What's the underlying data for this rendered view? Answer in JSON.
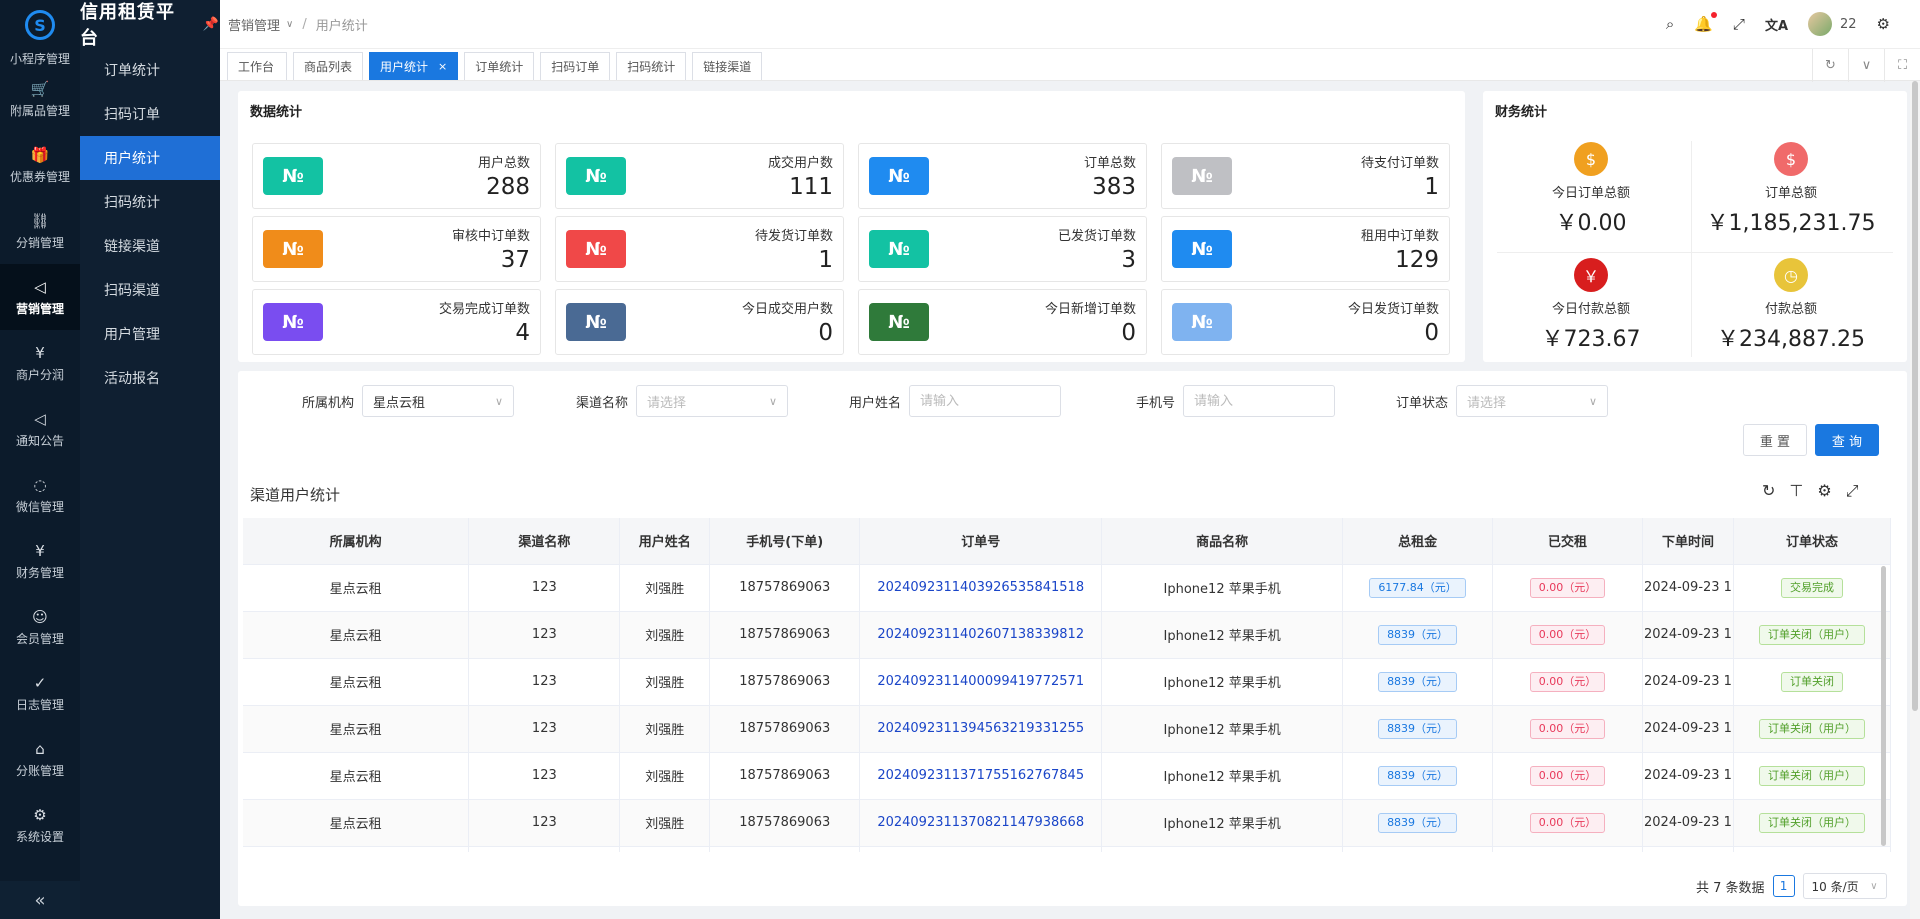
{
  "app": {
    "title": "信用租赁平台"
  },
  "leftbar": {
    "items": [
      {
        "label": "小程序管理",
        "icon": "mini-program-icon",
        "glyph": ""
      },
      {
        "label": "附属品管理",
        "icon": "cart-icon",
        "glyph": "🛒"
      },
      {
        "label": "优惠券管理",
        "icon": "gift-icon",
        "glyph": "🎁"
      },
      {
        "label": "分销管理",
        "icon": "distribution-icon",
        "glyph": "⛓"
      },
      {
        "label": "营销管理",
        "icon": "megaphone-icon",
        "glyph": "◁"
      },
      {
        "label": "商户分润",
        "icon": "yen-circle-icon",
        "glyph": "¥"
      },
      {
        "label": "通知公告",
        "icon": "notice-icon",
        "glyph": "◁"
      },
      {
        "label": "微信管理",
        "icon": "wechat-icon",
        "glyph": "◌"
      },
      {
        "label": "财务管理",
        "icon": "finance-icon",
        "glyph": "¥"
      },
      {
        "label": "会员管理",
        "icon": "member-icon",
        "glyph": "☺"
      },
      {
        "label": "日志管理",
        "icon": "shield-check-icon",
        "glyph": "✓"
      },
      {
        "label": "分账管理",
        "icon": "split-account-icon",
        "glyph": "⌂"
      },
      {
        "label": "系统设置",
        "icon": "gear-icon",
        "glyph": "⚙"
      }
    ],
    "active_index": 4,
    "collapse_glyph": "«"
  },
  "subbar": {
    "items": [
      "订单统计",
      "扫码订单",
      "用户统计",
      "扫码统计",
      "链接渠道",
      "扫码渠道",
      "用户管理",
      "活动报名"
    ],
    "active_index": 2
  },
  "breadcrumb": {
    "parent": "营销管理",
    "current": "用户统计"
  },
  "header": {
    "user_name": "22"
  },
  "tabs": [
    {
      "label": "工作台",
      "active": false
    },
    {
      "label": "商品列表",
      "active": false
    },
    {
      "label": "用户统计",
      "active": true
    },
    {
      "label": "订单统计",
      "active": false
    },
    {
      "label": "扫码订单",
      "active": false
    },
    {
      "label": "扫码统计",
      "active": false
    },
    {
      "label": "链接渠道",
      "active": false
    }
  ],
  "data_stats": {
    "title": "数据统计",
    "badge_glyph": "№",
    "items": [
      {
        "label": "用户总数",
        "value": "288",
        "color": "#13c2a3"
      },
      {
        "label": "成交用户数",
        "value": "111",
        "color": "#13c2a3"
      },
      {
        "label": "订单总数",
        "value": "383",
        "color": "#1f8bf0"
      },
      {
        "label": "待支付订单数",
        "value": "1",
        "color": "#bfc0c4"
      },
      {
        "label": "审核中订单数",
        "value": "37",
        "color": "#f08c1a"
      },
      {
        "label": "待发货订单数",
        "value": "1",
        "color": "#f04848"
      },
      {
        "label": "已发货订单数",
        "value": "3",
        "color": "#13c2a3"
      },
      {
        "label": "租用中订单数",
        "value": "129",
        "color": "#1f8bf0"
      },
      {
        "label": "交易完成订单数",
        "value": "4",
        "color": "#7a4df0"
      },
      {
        "label": "今日成交用户数",
        "value": "0",
        "color": "#4a6a94"
      },
      {
        "label": "今日新增订单数",
        "value": "0",
        "color": "#2f7a3a"
      },
      {
        "label": "今日发货订单数",
        "value": "0",
        "color": "#7fb3f0"
      }
    ]
  },
  "finance": {
    "title": "财务统计",
    "items": [
      {
        "label": "今日订单总额",
        "value": "￥0.00",
        "icon": "money-bag-icon",
        "glyph": "$",
        "color": "#f0a020"
      },
      {
        "label": "订单总额",
        "value": "￥1,185,231.75",
        "icon": "money-hand-icon",
        "glyph": "$",
        "color": "#f06a6a"
      },
      {
        "label": "今日付款总额",
        "value": "￥723.67",
        "icon": "yen-coin-icon",
        "glyph": "￥",
        "color": "#d81e1e"
      },
      {
        "label": "付款总额",
        "value": "￥234,887.25",
        "icon": "clock-coin-icon",
        "glyph": "◷",
        "color": "#e8c43a"
      }
    ]
  },
  "filters": {
    "org": {
      "label": "所属机构",
      "value": "星点云租"
    },
    "channel": {
      "label": "渠道名称",
      "placeholder": "请选择"
    },
    "user_name": {
      "label": "用户姓名",
      "placeholder": "请输入"
    },
    "phone": {
      "label": "手机号",
      "placeholder": "请输入"
    },
    "order_status": {
      "label": "订单状态",
      "placeholder": "请选择"
    },
    "reset": "重 置",
    "query": "查 询"
  },
  "table": {
    "title": "渠道用户统计",
    "columns": [
      "所属机构",
      "渠道名称",
      "用户姓名",
      "手机号(下单)",
      "订单号",
      "商品名称",
      "总租金",
      "已交租",
      "下单时间",
      "订单状态"
    ],
    "rows": [
      {
        "org": "星点云租",
        "channel": "123",
        "name": "刘强胜",
        "phone": "18757869063",
        "order_no": "20240923114039265358415 18",
        "product": "Iphone12 苹果手机",
        "rent": "6177.84（元）",
        "paid": "0.00（元）",
        "time": "2024-09-23 1",
        "status": "交易完成"
      },
      {
        "org": "星点云租",
        "channel": "123",
        "name": "刘强胜",
        "phone": "18757869063",
        "order_no": "202409231140260713833981 2",
        "product": "Iphone12 苹果手机",
        "rent": "8839（元）",
        "paid": "0.00（元）",
        "time": "2024-09-23 1",
        "status": "订单关闭（用户）"
      },
      {
        "org": "星点云租",
        "channel": "123",
        "name": "刘强胜",
        "phone": "18757869063",
        "order_no": "202409231140009941977257 1",
        "product": "Iphone12 苹果手机",
        "rent": "8839（元）",
        "paid": "0.00（元）",
        "time": "2024-09-23 1",
        "status": "订单关闭"
      },
      {
        "org": "星点云租",
        "channel": "123",
        "name": "刘强胜",
        "phone": "18757869063",
        "order_no": "202409231139456321933125 5",
        "product": "Iphone12 苹果手机",
        "rent": "8839（元）",
        "paid": "0.00（元）",
        "time": "2024-09-23 1",
        "status": "订单关闭（用户）"
      },
      {
        "org": "星点云租",
        "channel": "123",
        "name": "刘强胜",
        "phone": "18757869063",
        "order_no": "202409231137175516276784 5",
        "product": "Iphone12 苹果手机",
        "rent": "8839（元）",
        "paid": "0.00（元）",
        "time": "2024-09-23 1",
        "status": "订单关闭（用户）"
      },
      {
        "org": "星点云租",
        "channel": "123",
        "name": "刘强胜",
        "phone": "18757869063",
        "order_no": "202409231137082114793866 8",
        "product": "Iphone12 苹果手机",
        "rent": "8839（元）",
        "paid": "0.00（元）",
        "time": "2024-09-23 1",
        "status": "订单关闭（用户）"
      }
    ]
  },
  "pagination": {
    "total_text": "共 7 条数据",
    "page": "1",
    "size": "10 条/页"
  }
}
